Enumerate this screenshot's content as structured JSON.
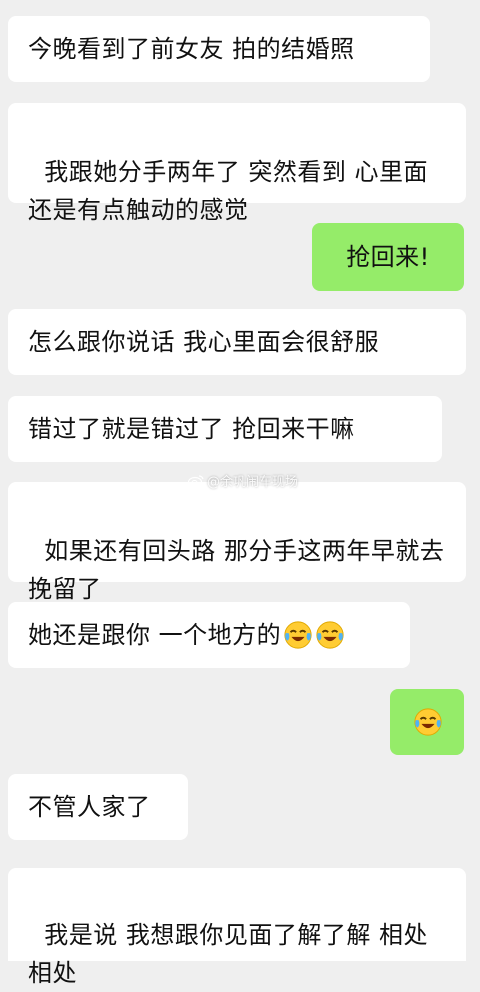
{
  "messages": [
    {
      "side": "in",
      "text": "今晚看到了前女友 拍的结婚照"
    },
    {
      "side": "in",
      "text": "我跟她分手两年了 突然看到 心里面还是有点触动的感觉"
    },
    {
      "side": "out",
      "text": "抢回来!"
    },
    {
      "side": "in",
      "text": "怎么跟你说话 我心里面会很舒服"
    },
    {
      "side": "in",
      "text": "错过了就是错过了 抢回来干嘛"
    },
    {
      "side": "in",
      "text": "如果还有回头路 那分手这两年早就去挽留了"
    },
    {
      "side": "in",
      "text": "她还是跟你 一个地方的",
      "emojis": [
        "crying-laughing-emoji",
        "crying-laughing-emoji"
      ]
    },
    {
      "side": "out",
      "text": "",
      "emojis": [
        "crying-laughing-emoji"
      ]
    },
    {
      "side": "in",
      "text": "不管人家了"
    },
    {
      "side": "in",
      "text": "我是说 我想跟你见面了解了解 相处相处"
    }
  ],
  "watermark": {
    "text": "@余巩闹车现场",
    "icon": "weibo-icon"
  },
  "colors": {
    "background": "#efefef",
    "incoming_bubble": "#ffffff",
    "outgoing_bubble": "#95ec69"
  }
}
